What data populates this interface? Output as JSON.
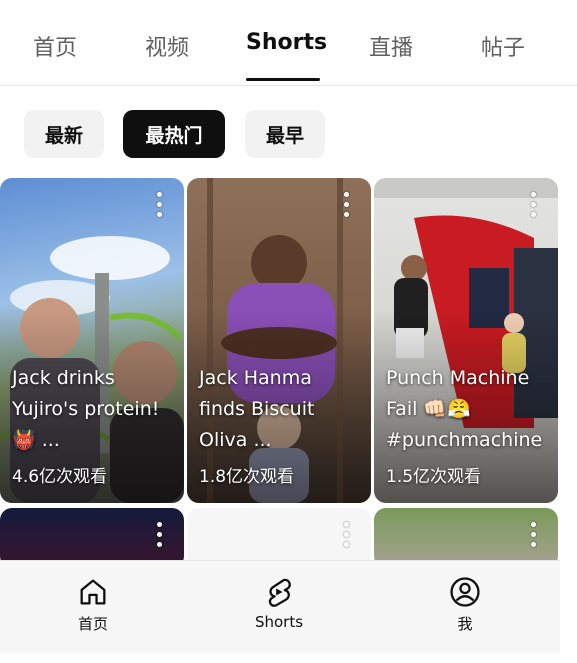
{
  "top_tabs": [
    {
      "label": "首页",
      "active": false
    },
    {
      "label": "视频",
      "active": false
    },
    {
      "label": "Shorts",
      "active": true
    },
    {
      "label": "直播",
      "active": false
    },
    {
      "label": "帖子",
      "active": false
    }
  ],
  "sort_chips": [
    {
      "label": "最新",
      "active": false
    },
    {
      "label": "最热门",
      "active": true
    },
    {
      "label": "最早",
      "active": false
    }
  ],
  "shorts": [
    {
      "title_line1": "Jack drinks",
      "title_line2": "Yujiro's protein!",
      "title_line3": "👹 ...",
      "views": "4.6亿次观看"
    },
    {
      "title_line1": "Jack Hanma",
      "title_line2": "finds Biscuit",
      "title_line3": "Oliva ...",
      "views": "1.8亿次观看"
    },
    {
      "title_line1": "Punch Machine",
      "title_line2": "Fail 👊🏻😤",
      "title_line3": "#punchmachine",
      "views": "1.5亿次观看"
    }
  ],
  "bottom_nav": [
    {
      "label": "首页",
      "icon": "home-icon"
    },
    {
      "label": "Shorts",
      "icon": "shorts-icon"
    },
    {
      "label": "我",
      "icon": "account-icon"
    }
  ]
}
